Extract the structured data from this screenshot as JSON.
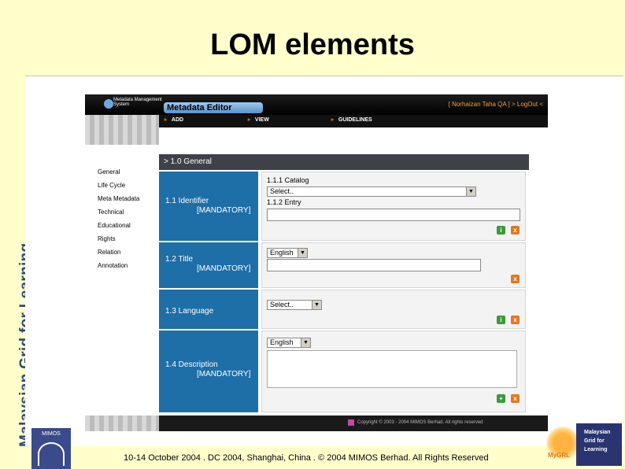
{
  "slide": {
    "title": "LOM elements",
    "vertical_label": "Malaysian Grid for Learning",
    "footer": "10-14 October 2004 . DC 2004, Shanghai, China . © 2004 MIMOS Berhad. All Rights Reserved"
  },
  "app": {
    "logo_text": "Metadata Management System",
    "title": "Metadata Editor",
    "user_link": "[ Norhaizan Taha QA ] > LogOut <",
    "nav": [
      {
        "label": "ADD"
      },
      {
        "label": "VIEW"
      },
      {
        "label": "GUIDELINES"
      }
    ],
    "sidebar": [
      {
        "label": "General"
      },
      {
        "label": "Life Cycle"
      },
      {
        "label": "Meta Metadata"
      },
      {
        "label": "Technical"
      },
      {
        "label": "Educational"
      },
      {
        "label": "Rights"
      },
      {
        "label": "Relation"
      },
      {
        "label": "Annotation"
      }
    ],
    "section_title": "> 1.0 General",
    "fields": {
      "identifier": {
        "label": "1.1 Identifier",
        "mandatory": "[MANDATORY]",
        "catalog_label": "1.1.1 Catalog",
        "catalog_value": "Select..",
        "entry_label": "1.1.2 Entry",
        "entry_value": ""
      },
      "title": {
        "label": "1.2 Title",
        "mandatory": "[MANDATORY]",
        "language": "English",
        "value": ""
      },
      "language": {
        "label": "1.3 Language",
        "value": "Select.."
      },
      "description": {
        "label": "1.4 Description",
        "mandatory": "[MANDATORY]",
        "language": "English",
        "value": ""
      }
    },
    "icons": {
      "info": "i",
      "delete": "x",
      "add": "+"
    },
    "copyright": "Copyright © 2003 - 2004 MIMOS Berhad. All rights reserved"
  },
  "logos": {
    "mimos": "MIMOS",
    "mygrid_lines": [
      "Malaysian",
      "Grid for",
      "Learning"
    ],
    "mygrid_mark": "MyGRL"
  }
}
